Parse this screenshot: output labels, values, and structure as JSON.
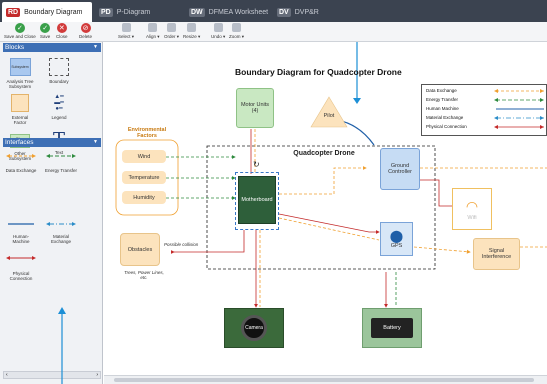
{
  "tabs": [
    {
      "badge": "RD",
      "label": "Boundary Diagram",
      "color": "#c42a2a"
    },
    {
      "badge": "PD",
      "label": "P-Diagram",
      "color": "#666d7a"
    },
    {
      "badge": "DW",
      "label": "DFMEA Worksheet",
      "color": "#666d7a"
    },
    {
      "badge": "DV",
      "label": "DVP&R",
      "color": "#666d7a"
    }
  ],
  "toolbar": {
    "save_close": "Save and Close",
    "save": "Save",
    "close": "Close",
    "delete": "Delete",
    "select": "Select ▾",
    "align": "Align ▾",
    "order": "Order ▾",
    "resize": "Resize ▾",
    "undo": "Undo ▾",
    "zoom": "Zoom ▾"
  },
  "sidebar": {
    "blocks_title": "Blocks",
    "interfaces_title": "Interfaces",
    "blocks": [
      {
        "label": "Analysis Tree Subsystem",
        "inner": "Subsystem"
      },
      {
        "label": "Boundary"
      },
      {
        "label": "External Factor"
      },
      {
        "label": "Legend"
      },
      {
        "label": "Other Subsystem",
        "inner": "Other Subsystem"
      },
      {
        "label": "Text",
        "glyph": "T"
      }
    ],
    "interfaces": [
      {
        "label": "Data Exchange"
      },
      {
        "label": "Energy Transfer"
      },
      {
        "label": "Human-Machine"
      },
      {
        "label": "Material Exchange"
      },
      {
        "label": "Physical Connection"
      }
    ]
  },
  "diagram": {
    "title": "Boundary Diagram for Quadcopter Drone",
    "system_title": "Quadcopter Drone",
    "env_title": "Environmental Factors",
    "env": [
      "Wind",
      "Temperature",
      "Humidity"
    ],
    "obstacles": "Obstacles",
    "obstacle_note": "Trees, Power Lines, etc.",
    "possible_collision": "Possible collision",
    "motor_units": "Motor Units (4)",
    "pilot": "Pilot",
    "ground_controller": "Ground Controller",
    "motherboard": "Motherboard",
    "gps": "GPS",
    "wifi": "Wifi",
    "signal": "Signal Interference",
    "camera": "Camera",
    "battery": "Battery"
  },
  "legend": [
    {
      "label": "Data Exchange",
      "color": "#f0a030",
      "style": "data"
    },
    {
      "label": "Energy Transfer",
      "color": "#2e8b3e",
      "style": "dash"
    },
    {
      "label": "Human Machine",
      "color": "#1f5fa8",
      "style": "solid"
    },
    {
      "label": "Material Exchange",
      "color": "#2a8cc8",
      "style": "dashdot"
    },
    {
      "label": "Physical Connection",
      "color": "#c42a2a",
      "style": "solid"
    }
  ],
  "colors": {
    "accent": "#3d6fb5",
    "orange": "#f0a030",
    "green": "#2e8b3e",
    "red": "#c42a2a",
    "blue": "#1f5fa8"
  }
}
